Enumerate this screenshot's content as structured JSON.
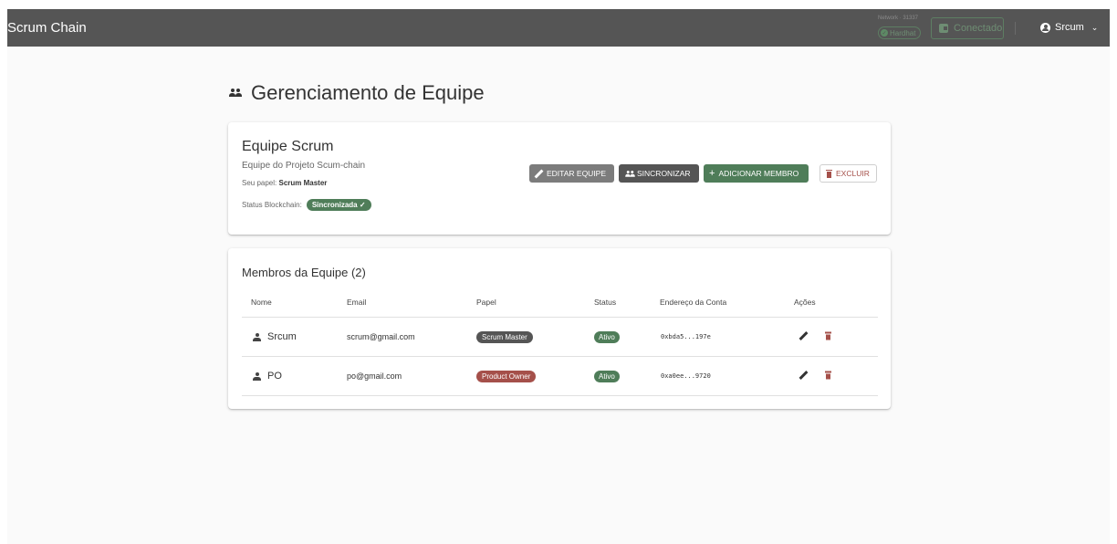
{
  "appbar": {
    "title": "Scrum Chain",
    "network_label": "Network · 31337",
    "network_chip": "Hardhat",
    "connection": "Conectado",
    "user": "Srcum"
  },
  "page": {
    "title": "Gerenciamento de Equipe"
  },
  "team": {
    "name": "Equipe Scrum",
    "description": "Equipe do Projeto Scum-chain",
    "role_label": "Seu papel:",
    "role_value": "Scrum Master",
    "status_label": "Status Blockchain:",
    "status_value": "Sincronizada ✓",
    "buttons": {
      "edit": "EDITAR EQUIPE",
      "sync": "SINCRONIZAR",
      "add": "ADICIONAR MEMBRO",
      "delete": "EXCLUIR"
    }
  },
  "members": {
    "title": "Membros da Equipe (2)",
    "columns": [
      "Nome",
      "Email",
      "Papel",
      "Status",
      "Endereço da Conta",
      "Ações"
    ],
    "rows": [
      {
        "name": "Srcum",
        "email": "scrum@gmail.com",
        "role": "Scrum Master",
        "status": "Ativo",
        "address": "0xbda5...197e"
      },
      {
        "name": "PO",
        "email": "po@gmail.com",
        "role": "Product Owner",
        "status": "Ativo",
        "address": "0xa0ee...9720"
      }
    ]
  },
  "colors": {
    "appbar": "#555555",
    "success": "#4f7d59",
    "danger": "#a5504a",
    "neutral": "#7c7c7c"
  }
}
